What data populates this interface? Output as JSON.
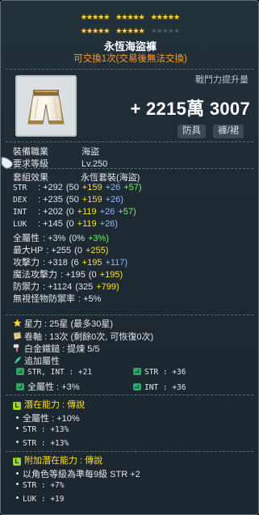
{
  "stars": {
    "total": 30,
    "filled": 25
  },
  "item": {
    "name": "永恆海盜褲",
    "tradable": "可交換1次(交易後無法交換)",
    "power_label": "戰鬥力提升量",
    "power_value": "+ 2215萬 3007",
    "tags": [
      "防具",
      "褲/裙"
    ]
  },
  "requirements": [
    {
      "label": "裝備職業",
      "value": "海盜"
    },
    {
      "label": "要求等級",
      "value": "Lv.250"
    }
  ],
  "set": {
    "label": "套組效果",
    "value": "永恆套裝(海盜)"
  },
  "stats": [
    {
      "label": "STR",
      "total": ": +292",
      "base": "(50",
      "star": "+159",
      "scroll": "+26",
      "flame": "+57)"
    },
    {
      "label": "DEX",
      "total": ": +235",
      "base": "(50",
      "star": "+159",
      "scroll": "+26)"
    },
    {
      "label": "INT",
      "total": ": +202",
      "base": "(0",
      "star": "+119",
      "scroll": "+26",
      "flame": "+57)"
    },
    {
      "label": "LUK",
      "total": ": +145",
      "base": "(0",
      "star": "+119",
      "scroll": "+26)"
    },
    {
      "label": "全屬性",
      "total": ": +3%",
      "base": "(0%",
      "flame": "+3%)"
    },
    {
      "label": "最大HP",
      "total": ": +255",
      "base": "(0",
      "star": "+255)"
    },
    {
      "label": "攻擊力",
      "total": ": +318",
      "base": "(6",
      "star": "+195",
      "scroll": "+117)"
    },
    {
      "label": "魔法攻擊力",
      "total": ": +195",
      "base": "(0",
      "star": "+195)"
    },
    {
      "label": "防禦力",
      "total": ": +1124",
      "base": "(325",
      "star": "+799)"
    },
    {
      "label": "無視怪物防禦率",
      "total": ": +5%"
    }
  ],
  "enhance": {
    "starforce": "星力 : 25星 (最多30星)",
    "scroll": "卷軸 : 13次 (剩餘0次, 可恢復0次)",
    "hammer": "白金鐵鎚 : 提煉 5/5",
    "extra_label": "追加屬性",
    "extra_lines": [
      {
        "left": "STR, INT : +21",
        "right": "STR : +36"
      },
      {
        "left": "全屬性 : +3%",
        "right": "INT : +36"
      }
    ]
  },
  "potential": {
    "badge": "L",
    "title": "潛在能力 : 傳說",
    "lines": [
      "全屬性 : +10%",
      "STR : +13%",
      "STR : +13%"
    ]
  },
  "additional": {
    "badge": "L",
    "title": "附加潛在能力 : 傳說",
    "lines": [
      "以角色等級為準每9級 STR +2",
      "STR : +7%",
      "LUK : +19"
    ]
  },
  "colors": {
    "star": "#ffd42a",
    "orange": "#ff9a2e",
    "yellow": "#ffe21a",
    "blue": "#8fb9ff",
    "green": "#77f06f",
    "badge": "#9bd439"
  }
}
